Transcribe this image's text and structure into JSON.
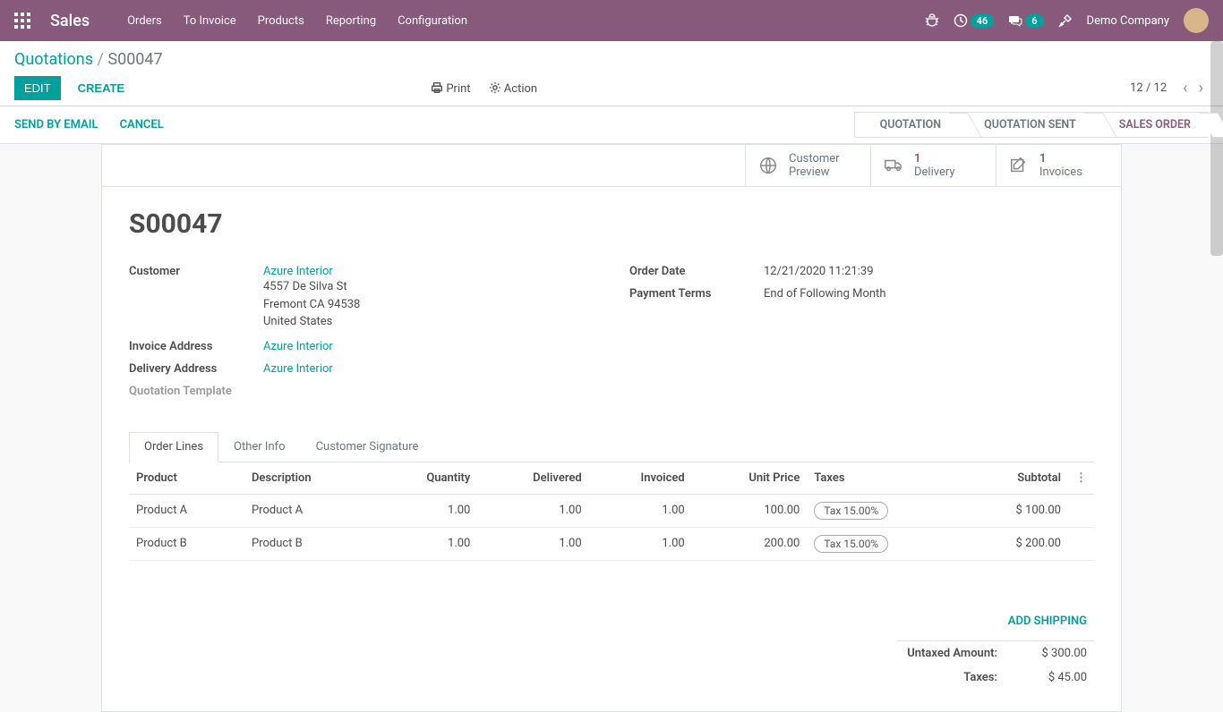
{
  "topnav": {
    "brand": "Sales",
    "menu": [
      "Orders",
      "To Invoice",
      "Products",
      "Reporting",
      "Configuration"
    ],
    "badge1": "46",
    "badge2": "6",
    "company": "Demo Company"
  },
  "breadcrumb": {
    "root": "Quotations",
    "current": "S00047"
  },
  "buttons": {
    "edit": "EDIT",
    "create": "CREATE",
    "print": "Print",
    "action": "Action"
  },
  "pager": {
    "counter": "12 / 12"
  },
  "statusbar": {
    "send": "SEND BY EMAIL",
    "cancel": "CANCEL"
  },
  "steps": [
    "QUOTATION",
    "QUOTATION SENT",
    "SALES ORDER"
  ],
  "statbtns": {
    "preview": {
      "l1": "Customer",
      "l2": "Preview"
    },
    "delivery": {
      "count": "1",
      "label": "Delivery"
    },
    "invoices": {
      "count": "1",
      "label": "Invoices"
    }
  },
  "order": {
    "name": "S00047",
    "customer_label": "Customer",
    "customer_name": "Azure Interior",
    "addr1": "4557 De Silva St",
    "addr2": "Fremont CA 94538",
    "addr3": "United States",
    "invoice_label": "Invoice Address",
    "invoice_val": "Azure Interior",
    "delivery_label": "Delivery Address",
    "delivery_val": "Azure Interior",
    "template_label": "Quotation Template",
    "orderdate_label": "Order Date",
    "orderdate_val": "12/21/2020 11:21:39",
    "payterms_label": "Payment Terms",
    "payterms_val": "End of Following Month"
  },
  "tabs": [
    "Order Lines",
    "Other Info",
    "Customer Signature"
  ],
  "columns": {
    "product": "Product",
    "desc": "Description",
    "qty": "Quantity",
    "delivered": "Delivered",
    "invoiced": "Invoiced",
    "price": "Unit Price",
    "taxes": "Taxes",
    "subtotal": "Subtotal"
  },
  "lines": [
    {
      "product": "Product A",
      "desc": "Product A",
      "qty": "1.00",
      "delivered": "1.00",
      "invoiced": "1.00",
      "price": "100.00",
      "tax": "Tax 15.00%",
      "subtotal": "$ 100.00"
    },
    {
      "product": "Product B",
      "desc": "Product B",
      "qty": "1.00",
      "delivered": "1.00",
      "invoiced": "1.00",
      "price": "200.00",
      "tax": "Tax 15.00%",
      "subtotal": "$ 200.00"
    }
  ],
  "add_shipping": "ADD SHIPPING",
  "totals": {
    "untaxed_label": "Untaxed Amount:",
    "untaxed_val": "$ 300.00",
    "taxes_label": "Taxes:",
    "taxes_val": "$ 45.00"
  }
}
